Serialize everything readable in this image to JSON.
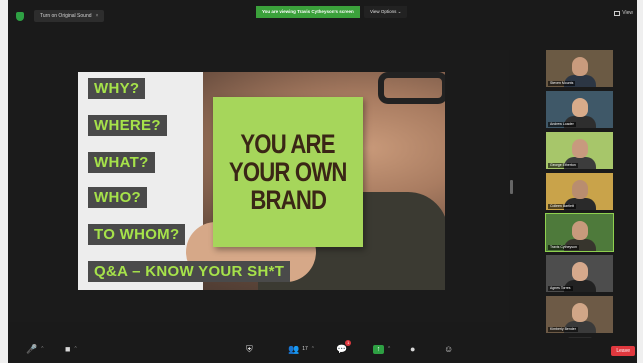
{
  "topbar": {
    "original_sound_label": "Turn on Original Sound",
    "original_sound_close": "×",
    "share_banner": "You are viewing Travis Cytheyson's screen",
    "view_options": "View Options ⌄",
    "grid_view_label": "View"
  },
  "slide": {
    "questions": [
      "WHY?",
      "WHERE?",
      "WHAT?",
      "WHO?",
      "TO WHOM?",
      "Q&A – KNOW YOUR SH*T"
    ],
    "sticky_note": [
      "YOU ARE",
      "YOUR OWN",
      "BRAND"
    ],
    "colors": {
      "label_bg": "#4a4a4a",
      "label_text": "#a6e24a",
      "sticky": "#a6d65b"
    }
  },
  "participants": [
    {
      "name": "Steven Mounts",
      "active": false,
      "bg": "#6b5a44",
      "skin": "#c99b7d",
      "shirt": "#2c3644"
    },
    {
      "name": "Andrew Loader",
      "active": false,
      "bg": "#3f5868",
      "skin": "#d8ab8a",
      "shirt": "#2e2e2e"
    },
    {
      "name": "George Etherton",
      "active": false,
      "bg": "#a7c66a",
      "skin": "#c89a7e",
      "shirt": "#3c3c3c"
    },
    {
      "name": "Colleen Bartlett",
      "active": false,
      "bg": "#c9a34a",
      "skin": "#b98d6f",
      "shirt": "#2a2a2a"
    },
    {
      "name": "Travis Cytheyson",
      "active": true,
      "bg": "#4e7a3b",
      "skin": "#c79a7c",
      "shirt": "#37352d"
    },
    {
      "name": "Agnes Torres",
      "active": false,
      "bg": "#4d4d4d",
      "skin": "#d6a98c",
      "shirt": "#222222"
    },
    {
      "name": "Kimberly Bender",
      "active": false,
      "bg": "#6d5a46",
      "skin": "#d1a687",
      "shirt": "#3a3a3a"
    }
  ],
  "thumbs_more": "⌄",
  "toolbar": {
    "mute_icon": "🎤",
    "video_icon": "■",
    "security_icon": "⛨",
    "participants_icon": "👥",
    "participants_count": "17",
    "chat_icon": "💬",
    "chat_badge": "1",
    "share_icon": "↑",
    "record_icon": "●",
    "reactions_icon": "☺",
    "caret": "⌃",
    "leave_label": "Leave"
  }
}
